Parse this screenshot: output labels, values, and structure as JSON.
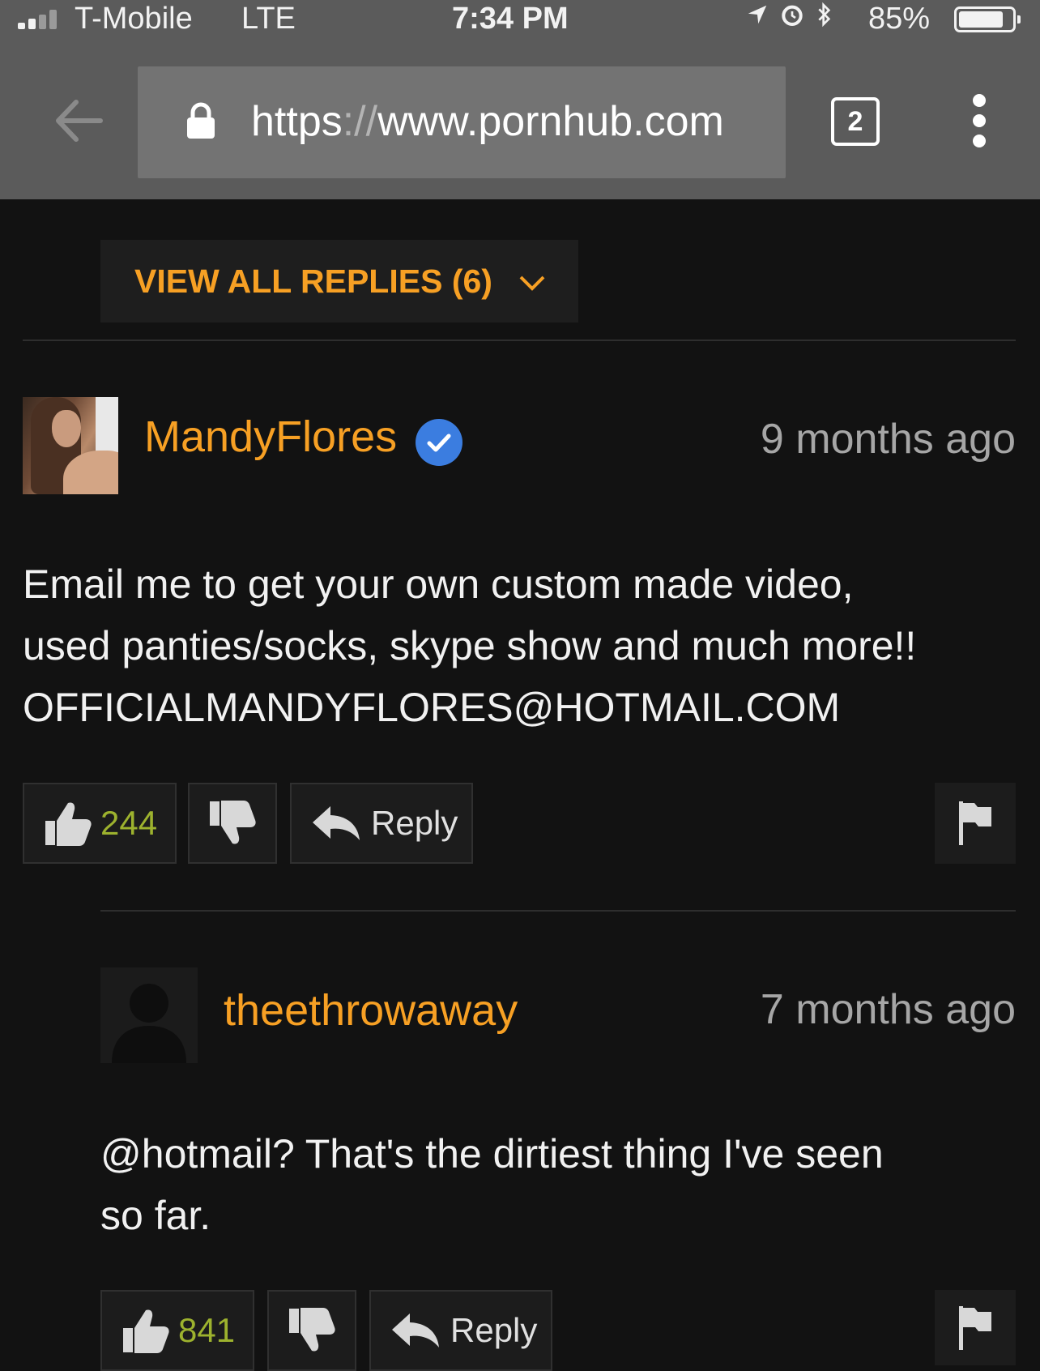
{
  "status_bar": {
    "carrier": "T-Mobile",
    "network": "LTE",
    "time": "7:34 PM",
    "battery_percent": "85%",
    "battery_level": 0.85,
    "signal_bars": 2,
    "icons": [
      "location-arrow-icon",
      "alarm-icon",
      "bluetooth-icon"
    ]
  },
  "browser": {
    "url_scheme": "https",
    "url_separator": "://",
    "url_host": "www.pornhub.com",
    "tab_count": "2"
  },
  "thread": {
    "view_all_replies_label": "VIEW ALL REPLIES (6)"
  },
  "comments": [
    {
      "username": "MandyFlores",
      "verified": true,
      "time_ago": "9 months ago",
      "text_lines": [
        "Email me to get your own custom made video,",
        "used panties/socks, skype show and much more!!",
        "OFFICIALMANDYFLORES@HOTMAIL.COM"
      ],
      "likes": "244",
      "reply_label": "Reply"
    },
    {
      "username": "theethrowaway",
      "verified": false,
      "time_ago": "7 months ago",
      "text_lines": [
        "@hotmail? That's the dirtiest thing I've seen",
        "so far."
      ],
      "likes": "841",
      "reply_label": "Reply"
    }
  ],
  "colors": {
    "accent": "#f7a024",
    "like_count": "#9db22e",
    "verified": "#3b7de0",
    "background": "#121212",
    "chrome": "#5b5b5b"
  }
}
